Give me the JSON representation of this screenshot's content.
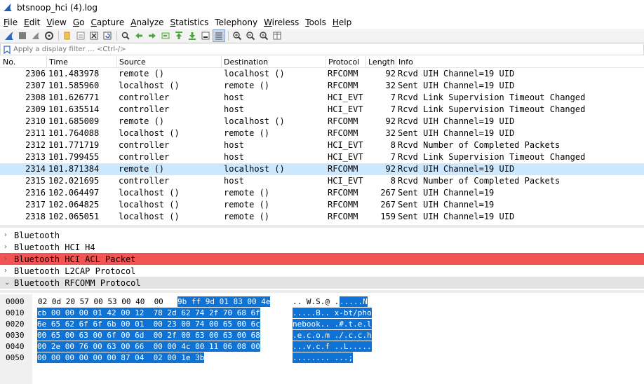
{
  "window": {
    "title": "btsnoop_hci (4).log"
  },
  "menu": [
    {
      "key": "F",
      "rest": "ile"
    },
    {
      "key": "E",
      "rest": "dit"
    },
    {
      "key": "V",
      "rest": "iew"
    },
    {
      "key": "G",
      "rest": "o"
    },
    {
      "key": "C",
      "rest": "apture"
    },
    {
      "key": "A",
      "rest": "nalyze"
    },
    {
      "key": "S",
      "rest": "tatistics"
    },
    {
      "key": "",
      "rest": "Telephony"
    },
    {
      "key": "W",
      "rest": "ireless"
    },
    {
      "key": "T",
      "rest": "ools"
    },
    {
      "key": "H",
      "rest": "elp"
    }
  ],
  "filter": {
    "placeholder": "Apply a display filter … <Ctrl-/>"
  },
  "packet_list": {
    "columns": [
      "No.",
      "Time",
      "Source",
      "Destination",
      "Protocol",
      "Length",
      "Info"
    ],
    "selected_no": "2314",
    "rows": [
      {
        "no": "2306",
        "time": "101.483978",
        "src": "remote ()",
        "dst": "localhost ()",
        "proto": "RFCOMM",
        "len": "92",
        "info": "Rcvd UIH Channel=19 UID"
      },
      {
        "no": "2307",
        "time": "101.585960",
        "src": "localhost ()",
        "dst": "remote ()",
        "proto": "RFCOMM",
        "len": "32",
        "info": "Sent UIH Channel=19 UID"
      },
      {
        "no": "2308",
        "time": "101.626771",
        "src": "controller",
        "dst": "host",
        "proto": "HCI_EVT",
        "len": "7",
        "info": "Rcvd Link Supervision Timeout Changed"
      },
      {
        "no": "2309",
        "time": "101.635514",
        "src": "controller",
        "dst": "host",
        "proto": "HCI_EVT",
        "len": "7",
        "info": "Rcvd Link Supervision Timeout Changed"
      },
      {
        "no": "2310",
        "time": "101.685009",
        "src": "remote ()",
        "dst": "localhost ()",
        "proto": "RFCOMM",
        "len": "92",
        "info": "Rcvd UIH Channel=19 UID"
      },
      {
        "no": "2311",
        "time": "101.764088",
        "src": "localhost ()",
        "dst": "remote ()",
        "proto": "RFCOMM",
        "len": "32",
        "info": "Sent UIH Channel=19 UID"
      },
      {
        "no": "2312",
        "time": "101.771719",
        "src": "controller",
        "dst": "host",
        "proto": "HCI_EVT",
        "len": "8",
        "info": "Rcvd Number of Completed Packets"
      },
      {
        "no": "2313",
        "time": "101.799455",
        "src": "controller",
        "dst": "host",
        "proto": "HCI_EVT",
        "len": "7",
        "info": "Rcvd Link Supervision Timeout Changed"
      },
      {
        "no": "2314",
        "time": "101.871384",
        "src": "remote ()",
        "dst": "localhost ()",
        "proto": "RFCOMM",
        "len": "92",
        "info": "Rcvd UIH Channel=19 UID"
      },
      {
        "no": "2315",
        "time": "102.021695",
        "src": "controller",
        "dst": "host",
        "proto": "HCI_EVT",
        "len": "8",
        "info": "Rcvd Number of Completed Packets"
      },
      {
        "no": "2316",
        "time": "102.064497",
        "src": "localhost ()",
        "dst": "remote ()",
        "proto": "RFCOMM",
        "len": "267",
        "info": "Sent UIH Channel=19"
      },
      {
        "no": "2317",
        "time": "102.064825",
        "src": "localhost ()",
        "dst": "remote ()",
        "proto": "RFCOMM",
        "len": "267",
        "info": "Sent UIH Channel=19"
      },
      {
        "no": "2318",
        "time": "102.065051",
        "src": "localhost ()",
        "dst": "remote ()",
        "proto": "RFCOMM",
        "len": "159",
        "info": "Sent UIH Channel=19 UID"
      }
    ]
  },
  "details": [
    {
      "label": "Bluetooth",
      "expanded": false,
      "state": "normal"
    },
    {
      "label": "Bluetooth HCI H4",
      "expanded": false,
      "state": "normal"
    },
    {
      "label": "Bluetooth HCI ACL Packet",
      "expanded": false,
      "state": "error"
    },
    {
      "label": "Bluetooth L2CAP Protocol",
      "expanded": false,
      "state": "normal"
    },
    {
      "label": "Bluetooth RFCOMM Protocol",
      "expanded": true,
      "state": "selected"
    }
  ],
  "bytes": [
    {
      "offset": "0000",
      "hex_a": "02 0d 20 57 00 53 00 40  00",
      "hex_b": "9b ff 9d 01 83 00 4e",
      "ascii_a": ".. W.S.@ .",
      "ascii_b": ".....N"
    },
    {
      "offset": "0010",
      "hex_a": "",
      "hex_b": "cb 00 00 00 01 42 00 12  78 2d 62 74 2f 70 68 6f",
      "ascii_a": "",
      "ascii_b": ".....B.. x-bt/pho"
    },
    {
      "offset": "0020",
      "hex_a": "",
      "hex_b": "6e 65 62 6f 6f 6b 00 01  00 23 00 74 00 65 00 6c",
      "ascii_a": "",
      "ascii_b": "nebook.. .#.t.e.l"
    },
    {
      "offset": "0030",
      "hex_a": "",
      "hex_b": "00 65 00 63 00 6f 00 6d  00 2f 00 63 00 63 00 68",
      "ascii_a": "",
      "ascii_b": ".e.c.o.m ./.c.c.h"
    },
    {
      "offset": "0040",
      "hex_a": "",
      "hex_b": "00 2e 00 76 00 63 00 66  00 00 4c 00 11 06 08 00",
      "ascii_a": "",
      "ascii_b": "...v.c.f ..L....."
    },
    {
      "offset": "0050",
      "hex_a": "",
      "hex_b": "00 00 00 00 00 00 87 04  02 00 1e 3b",
      "ascii_a": "",
      "ascii_b": "........ ...;"
    }
  ],
  "colors": {
    "selected_row": "#cce8ff",
    "error_row": "#f25454",
    "bytes_highlight": "#0f73d6"
  }
}
